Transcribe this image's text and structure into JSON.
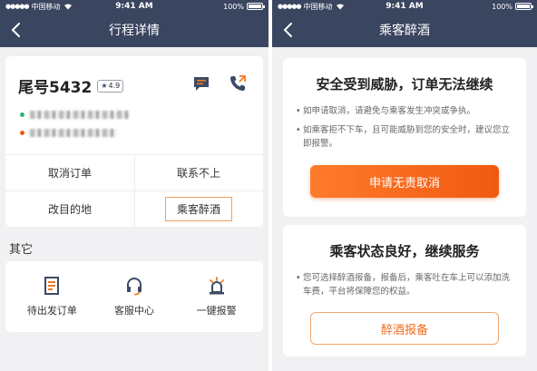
{
  "status_bar": {
    "carrier": "中国移动",
    "time": "9:41 AM",
    "battery": "100%"
  },
  "left_screen": {
    "nav_title": "行程详情",
    "trip": {
      "tail_number": "尾号5432",
      "rating": "4.9"
    },
    "actions": {
      "cancel_order": "取消订单",
      "cannot_contact": "联系不上",
      "change_destination": "改目的地",
      "drunk_passenger": "乘客醉酒"
    },
    "other_section_title": "其它",
    "other_items": [
      {
        "label": "待出发订单",
        "icon": "order-list-icon"
      },
      {
        "label": "客服中心",
        "icon": "headset-icon"
      },
      {
        "label": "一键报警",
        "icon": "alarm-icon"
      }
    ]
  },
  "right_screen": {
    "nav_title": "乘客醉酒",
    "safety": {
      "title": "安全受到威胁，订单无法继续",
      "tips": [
        "如申请取消，请避免与乘客发生冲突或争执。",
        "如乘客拒不下车，且可能威胁到您的安全时，建议您立即报警。"
      ],
      "button": "申请无责取消"
    },
    "service": {
      "title": "乘客状态良好，继续服务",
      "tips": [
        "您可选择醉酒报备，报备后，乘客吐在车上可以添加洗车费，平台将保障您的权益。"
      ],
      "button": "醉酒报备"
    }
  },
  "colors": {
    "nav_bg": "#3a4560",
    "accent_orange": "#f26b1d",
    "icon_orange": "#f07a22",
    "page_bg": "#f1f1f3"
  }
}
